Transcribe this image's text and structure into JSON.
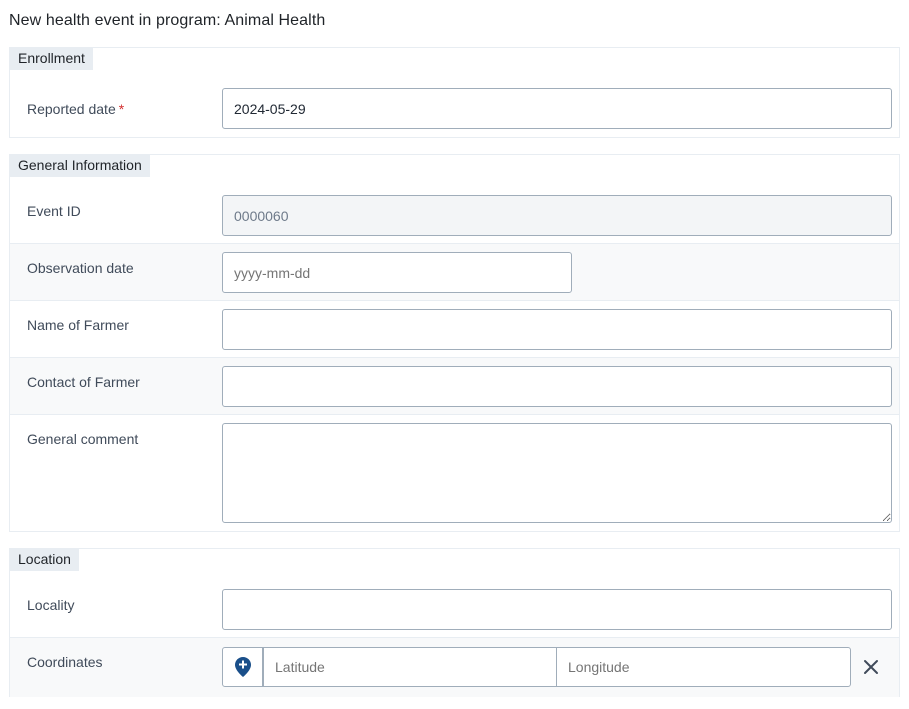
{
  "page": {
    "title": "New health event in program: Animal Health"
  },
  "enrollment": {
    "header": "Enrollment",
    "reported_date_label": "Reported date",
    "required_marker": "*",
    "reported_date_value": "2024-05-29"
  },
  "general": {
    "header": "General Information",
    "event_id_label": "Event ID",
    "event_id_value": "0000060",
    "observation_date_label": "Observation date",
    "observation_date_placeholder": "yyyy-mm-dd",
    "farmer_name_label": "Name of Farmer",
    "farmer_name_value": "",
    "farmer_contact_label": "Contact of Farmer",
    "farmer_contact_value": "",
    "comment_label": "General comment",
    "comment_value": ""
  },
  "location": {
    "header": "Location",
    "locality_label": "Locality",
    "locality_value": "",
    "coordinates_label": "Coordinates",
    "latitude_placeholder": "Latitude",
    "longitude_placeholder": "Longitude"
  },
  "colors": {
    "section_header_bg": "#e8edf2",
    "required": "#d32f2f",
    "map_pin": "#1a4f8a"
  },
  "icons": {
    "coordinates_button": "map-pin-plus-icon",
    "clear_button": "close-icon"
  }
}
